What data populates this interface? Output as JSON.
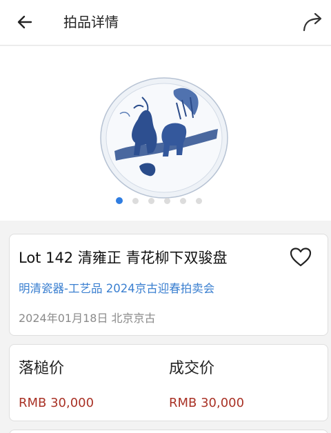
{
  "header": {
    "title": "拍品详情",
    "back_icon": "arrow-left-icon",
    "share_icon": "share-arrow-icon"
  },
  "gallery": {
    "image_alt": "blue-and-white porcelain plate",
    "dot_count": 6,
    "active_index": 0,
    "active_color": "#2f7de1"
  },
  "lot": {
    "title": "Lot 142 清雍正  青花柳下双骏盘",
    "auction": "明清瓷器-工艺品 2024京古迎春拍卖会",
    "date_place": "2024年01月18日 北京京古",
    "favorite_icon": "heart-outline-icon"
  },
  "prices": {
    "hammer_label": "落槌价",
    "hammer_value": "RMB 30,000",
    "deal_label": "成交价",
    "deal_value": "RMB 30,000",
    "value_color": "#a93226"
  }
}
